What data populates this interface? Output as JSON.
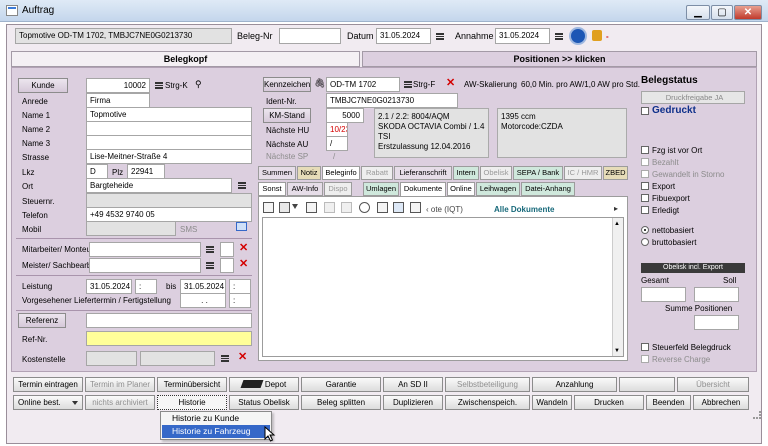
{
  "window": {
    "title": "Auftrag",
    "min": "▁",
    "max": "▢",
    "close": "✕"
  },
  "toolbar": {
    "customer_vehicle": "Topmotive OD-TM 1702, TMBJC7NE0G0213730",
    "beleg_label": "Beleg-Nr",
    "beleg_value": "",
    "datum_label": "Datum",
    "datum_value": "31.05.2024",
    "annahme_label": "Annahme",
    "annahme_value": "31.05.2024",
    "dash": "-"
  },
  "tabs": {
    "left": "Belegkopf",
    "right": "Positionen >> klicken"
  },
  "customer": {
    "kunde_label": "Kunde",
    "kunde_value": "10002",
    "strg_k": "Strg-K",
    "anrede_label": "Anrede",
    "anrede_value": "Firma",
    "name1_label": "Name 1",
    "name1_value": "Topmotive",
    "name2_label": "Name 2",
    "name2_value": "",
    "name3_label": "Name 3",
    "name3_value": "",
    "strasse_label": "Strasse",
    "strasse_value": "Lise-Meitner-Straße 4",
    "lkz_label": "Lkz",
    "lkz_value": "D",
    "plz_label": "Plz",
    "plz_value": "22941",
    "ort_label": "Ort",
    "ort_value": "Bargteheide",
    "steuernr_label": "Steuernr.",
    "steuernr_value": "",
    "telefon_label": "Telefon",
    "telefon_value": "+49 4532 9740 05",
    "mobil_label": "Mobil",
    "mobil_value": "",
    "sms": "SMS"
  },
  "staff": {
    "mitarbeiter_label": "Mitarbeiter/ Monteur",
    "meister_label": "Meister/ Sachbearb."
  },
  "leistung": {
    "label": "Leistung",
    "from": "31.05.2024",
    "from_time": ":",
    "bis": "bis",
    "to": "31.05.2024",
    "to_time": ":",
    "vorg_label": "Vorgesehener Liefertermin / Fertigstellung",
    "vorg_date": ". .",
    "vorg_time": ":"
  },
  "refs": {
    "referenz_label": "Referenz",
    "refnr_label": "Ref-Nr.",
    "kostenstelle_label": "Kostenstelle"
  },
  "vehicle": {
    "kennzeichen_label": "Kennzeichen",
    "kennzeichen_value": "OD-TM 1702",
    "strg_f": "Strg-F",
    "aw_label": "AW-Skalierung",
    "aw_value": "60,0 Min. pro AW/1,0 AW pro Std.",
    "ident_label": "Ident-Nr.",
    "ident_value": "TMBJC7NE0G0213730",
    "km_label": "KM-Stand",
    "km_value": "5000",
    "hu_label": "Nächste HU",
    "hu_value": "10/23",
    "au_label": "Nächste AU",
    "au_value": "/",
    "sp_label": "Nächste SP",
    "sp_value": "/",
    "desc1": "2.1 / 2.2: 8004/AQM",
    "desc2": "SKODA OCTAVIA Combi / 1.4",
    "desc3": "TSI",
    "desc4": "Erstzulassung 12.04.2016",
    "ccm": "1395 ccm",
    "motorcode": "Motorcode:CZDA"
  },
  "doctabs1": [
    "Summen",
    "Notiz",
    "Beleginfo",
    "Rabatt",
    "Lieferanschrift",
    "Intern",
    "Obelisk",
    "SEPA / Bank",
    "IC / HMR",
    "ZBED"
  ],
  "doctabs2": [
    "Sonst",
    "AW-Info",
    "Dispo",
    "Umlagen",
    "Dokumente",
    "Online",
    "Leihwagen",
    "Datei-Anhang"
  ],
  "docbar": {
    "path": "‹ ote (IQT)",
    "filter": "Alle Dokumente",
    "arrow": "▸"
  },
  "status": {
    "title": "Belegstatus",
    "druckfreigabe": "Druckfreigabe JA",
    "gedruckt": "Gedruckt",
    "checks": [
      "Fzg ist vor Ort",
      "Bezahlt",
      "Gewandelt in Storno",
      "Export",
      "Fibuexport",
      "Erledigt"
    ],
    "netto": "nettobasiert",
    "brutto": "bruttobasiert",
    "obelisk": "Obelisk incl. Export",
    "gesamt": "Gesamt",
    "soll": "Soll",
    "summe": "Summe Positionen",
    "steuerfeld": "Steuerfeld Belegdruck",
    "reverse": "Reverse Charge"
  },
  "buttons_row1": [
    "Termin eintragen",
    "Termin im Planer",
    "Terminübersicht",
    "Depot",
    "Garantie",
    "An SD II",
    "Selbstbeteiligung",
    "Anzahlung",
    "",
    "Übersicht"
  ],
  "buttons_row2": [
    "Online best.",
    "nichts archiviert",
    "Historie",
    "Status Obelisk",
    "Beleg splitten",
    "Duplizieren",
    "Zwischenspeich.",
    "Wandeln",
    "Drucken",
    "Beenden",
    "Abbrechen"
  ],
  "dropdown": {
    "item1": "Historie zu Kunde",
    "item2": "Historie zu Fahrzeug"
  },
  "colors": {
    "accent": "#3568c8",
    "panel": "#dccfdf",
    "frame": "#f1ebf1",
    "highlight_yellow": "#ffff99",
    "danger": "#d40000"
  }
}
